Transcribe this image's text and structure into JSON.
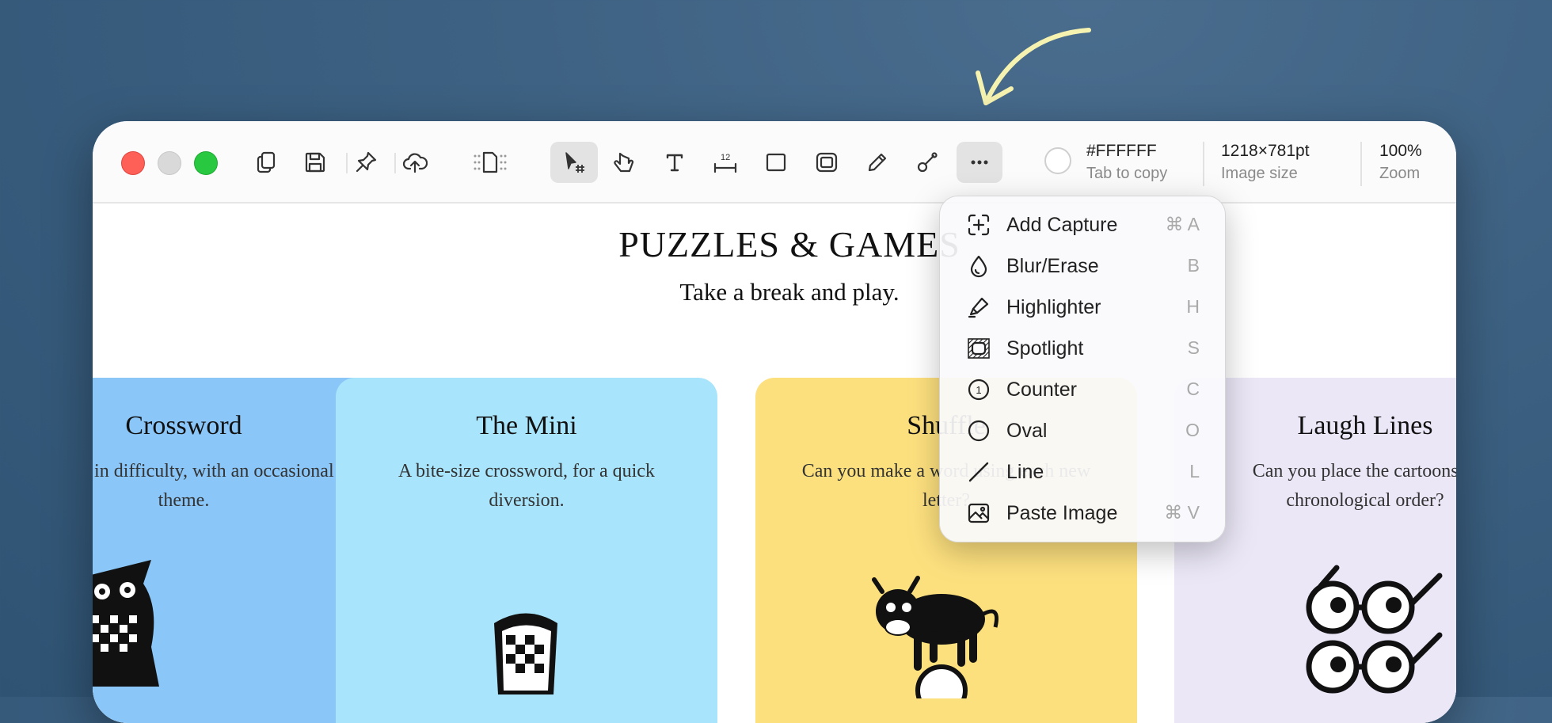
{
  "toolbar": {
    "color": {
      "hex": "#FFFFFF",
      "hint": "Tab to copy"
    },
    "image_size": {
      "value": "1218×781pt",
      "label": "Image size"
    },
    "zoom": {
      "value": "100%",
      "label": "Zoom"
    },
    "measure_number": "12"
  },
  "page": {
    "title": "PUZZLES & GAMES",
    "subtitle": "Take a break and play.",
    "cards": [
      {
        "title": "Crossword",
        "desc": "Ranges in difficulty, with an occasional theme.",
        "color": "#8ac6f8"
      },
      {
        "title": "The Mini",
        "desc": "A bite-size crossword, for a quick diversion.",
        "color": "#a8e4fb"
      },
      {
        "title": "Shuffle",
        "desc": "Can you make a word using each new letter?",
        "color": "#fde07e"
      },
      {
        "title": "Laugh Lines",
        "desc": "Can you place the cartoons in chronological order?",
        "color": "#ebe7f7"
      }
    ]
  },
  "menu": {
    "items": [
      {
        "label": "Add Capture",
        "shortcut": "⌘ A",
        "icon": "add-capture-icon"
      },
      {
        "label": "Blur/Erase",
        "shortcut": "B",
        "icon": "blur-drop-icon"
      },
      {
        "label": "Highlighter",
        "shortcut": "H",
        "icon": "highlighter-icon"
      },
      {
        "label": "Spotlight",
        "shortcut": "S",
        "icon": "spotlight-icon"
      },
      {
        "label": "Counter",
        "shortcut": "C",
        "icon": "counter-icon",
        "counter_number": "1"
      },
      {
        "label": "Oval",
        "shortcut": "O",
        "icon": "oval-icon"
      },
      {
        "label": "Line",
        "shortcut": "L",
        "icon": "line-icon"
      },
      {
        "label": "Paste Image",
        "shortcut": "⌘ V",
        "icon": "paste-image-icon"
      }
    ]
  },
  "colors": {
    "arrow": "#f6f2b0",
    "close": "#fe5f57",
    "zoom": "#28c840"
  }
}
